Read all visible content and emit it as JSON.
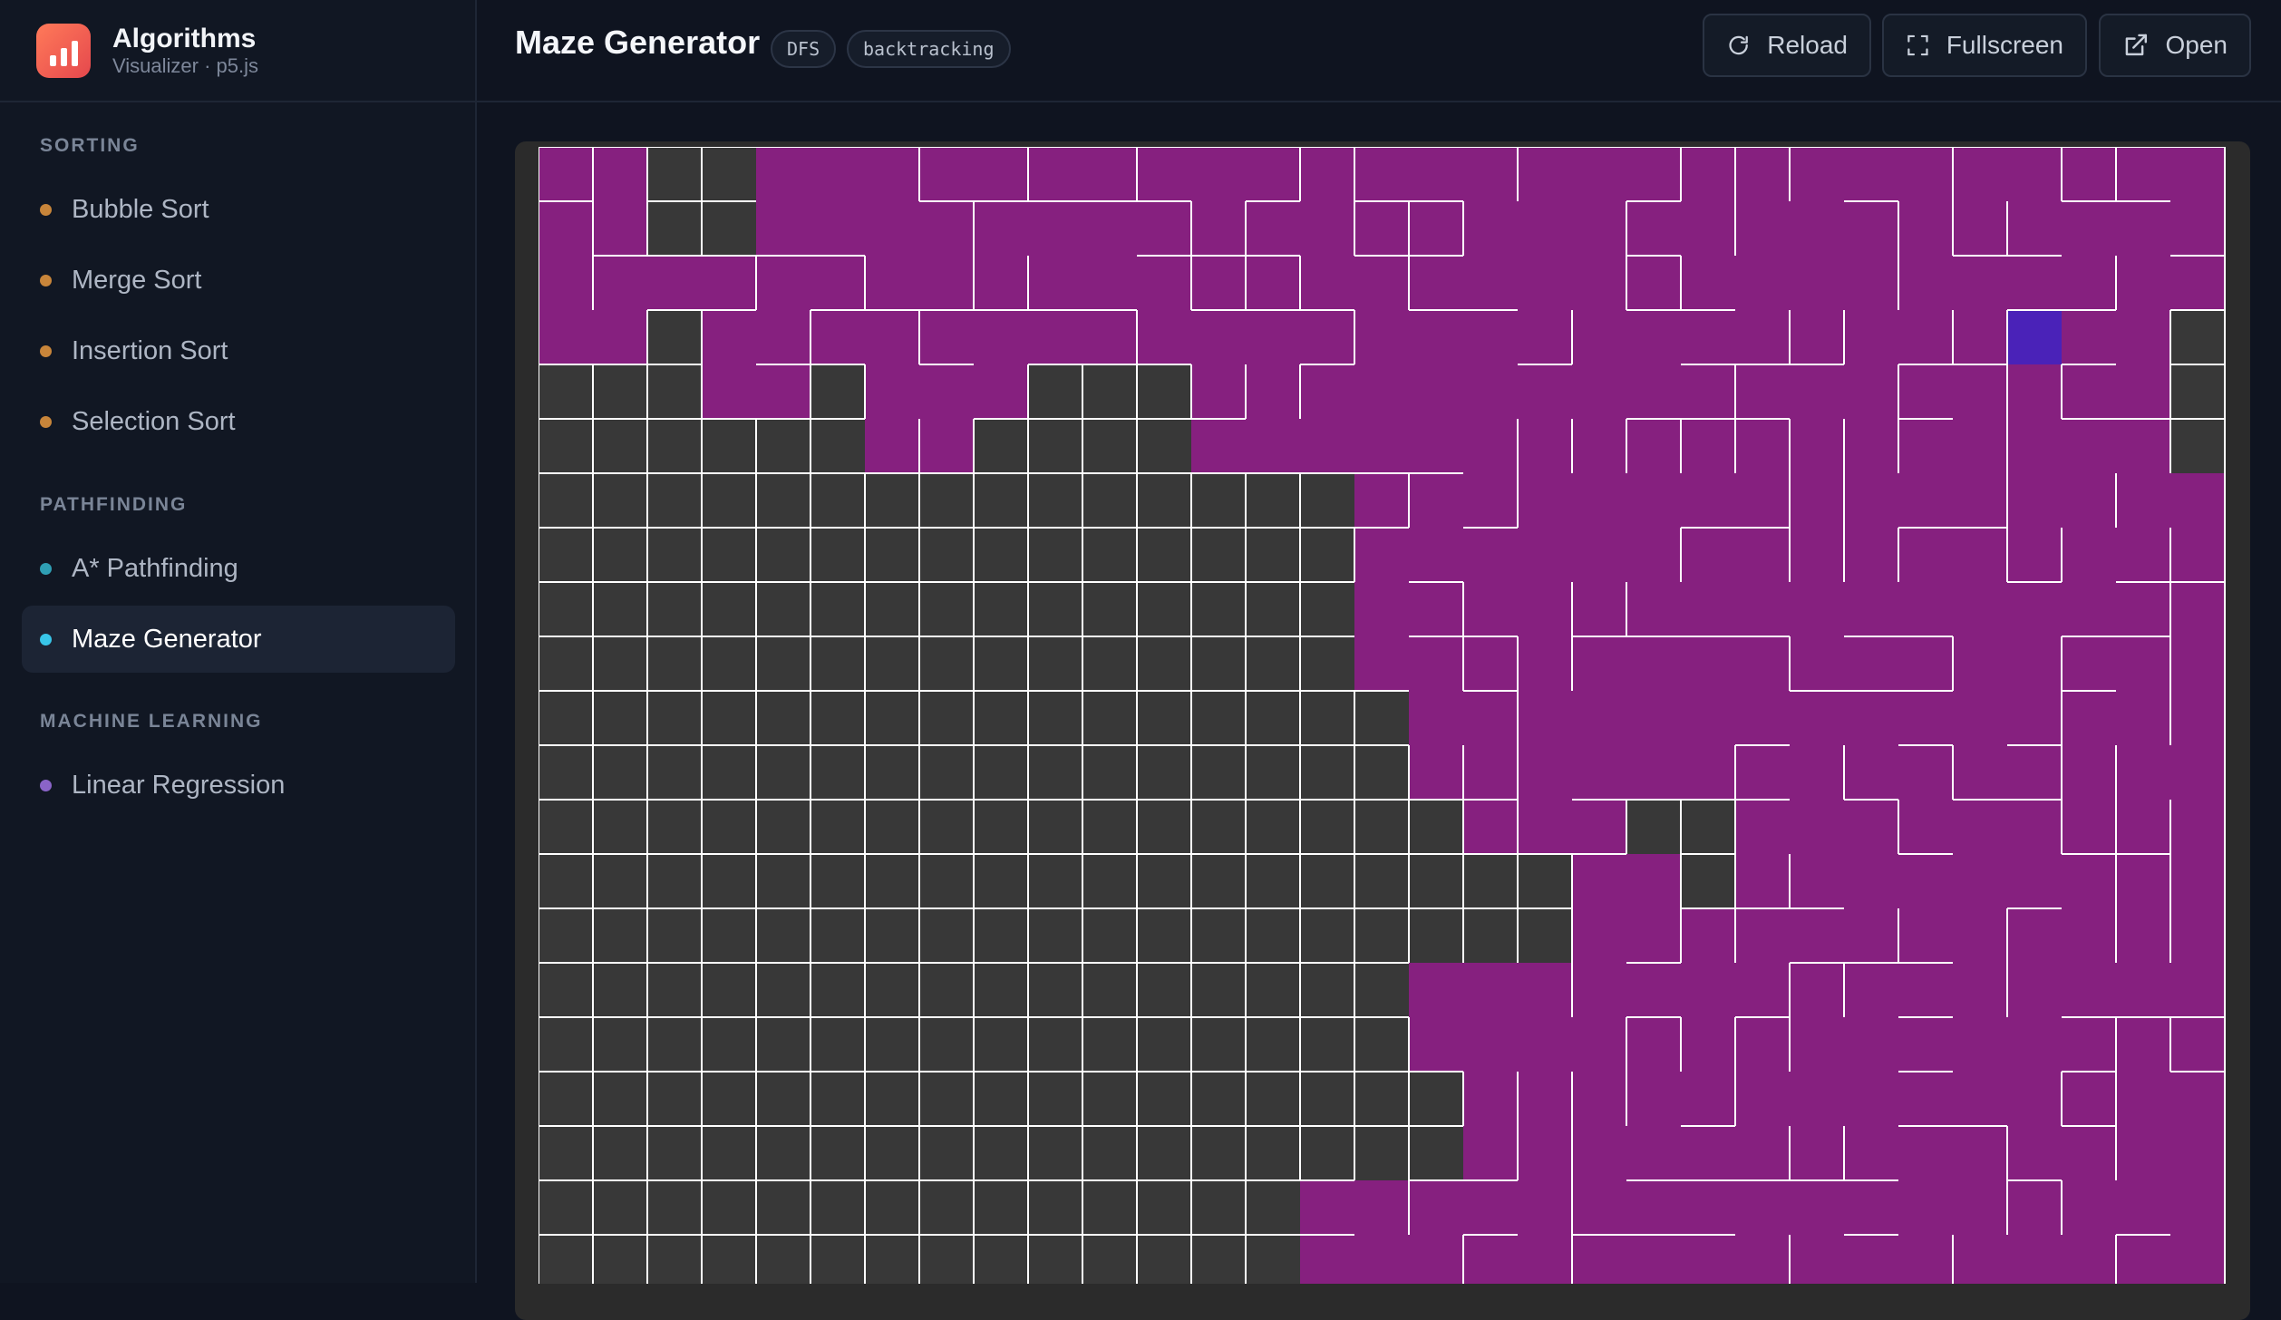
{
  "brand": {
    "title": "Algorithms",
    "subtitle": "Visualizer · p5.js",
    "icon": "bar-chart-icon"
  },
  "sidebar": {
    "sections": [
      {
        "title": "SORTING",
        "items": [
          {
            "label": "Bubble Sort",
            "dot_color": "#c8853a"
          },
          {
            "label": "Merge Sort",
            "dot_color": "#c8853a"
          },
          {
            "label": "Insertion Sort",
            "dot_color": "#c8853a"
          },
          {
            "label": "Selection Sort",
            "dot_color": "#c8853a"
          }
        ]
      },
      {
        "title": "PATHFINDING",
        "items": [
          {
            "label": "A* Pathfinding",
            "dot_color": "#2f9fb4"
          },
          {
            "label": "Maze Generator",
            "dot_color": "#38c5e8",
            "active": true
          }
        ]
      },
      {
        "title": "MACHINE LEARNING",
        "items": [
          {
            "label": "Linear Regression",
            "dot_color": "#8a64c8"
          }
        ]
      }
    ]
  },
  "header": {
    "title": "Maze Generator",
    "tags": [
      "DFS",
      "backtracking"
    ],
    "buttons": [
      {
        "label": "Reload",
        "icon": "reload-icon"
      },
      {
        "label": "Fullscreen",
        "icon": "fullscreen-icon"
      },
      {
        "label": "Open",
        "icon": "external-link-icon"
      }
    ]
  },
  "maze": {
    "algorithm": "DFS backtracking",
    "visited_color": "#86207f",
    "unvisited_color": "#383838",
    "current_color": "#4a22b8",
    "wall_color": "#ffffff",
    "cols": 31,
    "visible_rows": 21,
    "current_cell": {
      "row": 3,
      "col": 27
    }
  },
  "colors": {
    "background": "#0f1420",
    "sidebar": "#111723",
    "accent": "#38c5e8"
  }
}
